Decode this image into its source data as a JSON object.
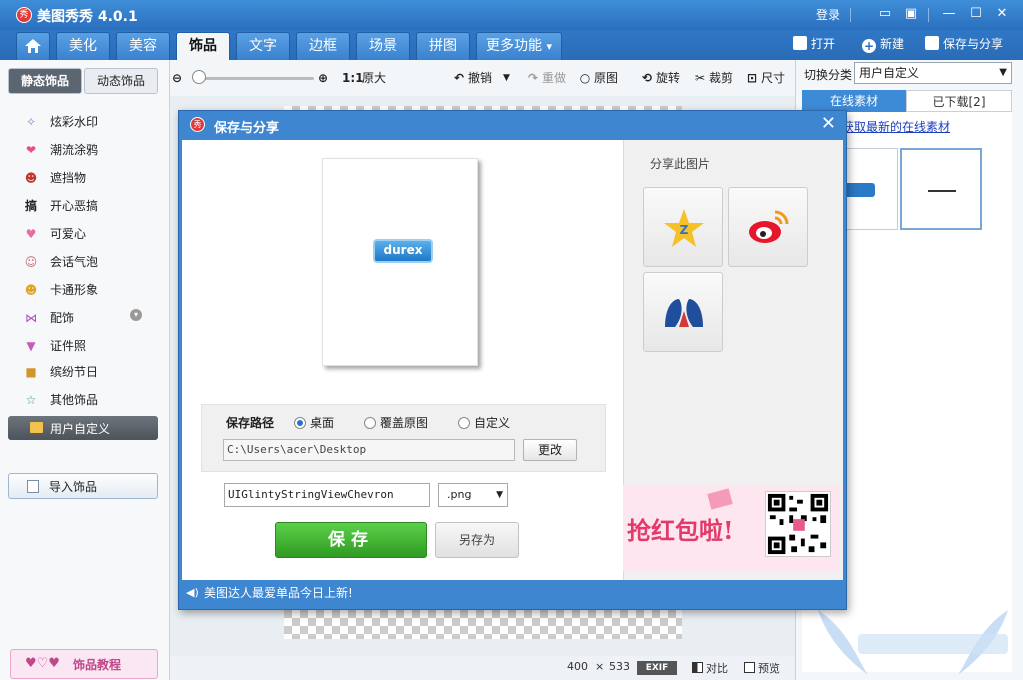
{
  "app": {
    "title": "美图秀秀 4.0.1",
    "login": "登录",
    "logo_text": "秀"
  },
  "menu": {
    "tabs": [
      {
        "label": "美化"
      },
      {
        "label": "美容"
      },
      {
        "label": "饰品"
      },
      {
        "label": "文字"
      },
      {
        "label": "边框"
      },
      {
        "label": "场景"
      },
      {
        "label": "拼图"
      },
      {
        "label": "更多功能"
      }
    ],
    "more_caret": "▾",
    "actions": {
      "open": "打开",
      "new": "新建",
      "save_share": "保存与分享"
    }
  },
  "left_panel": {
    "tab_static": "静态饰品",
    "tab_dynamic": "动态饰品",
    "items": [
      {
        "label": "炫彩水印",
        "icon": "sparkle-icon"
      },
      {
        "label": "潮流涂鸦",
        "icon": "lips-icon"
      },
      {
        "label": "遮挡物",
        "icon": "mask-icon"
      },
      {
        "label": "开心恶搞",
        "icon": "gao-icon"
      },
      {
        "label": "可爱心",
        "icon": "heart-icon"
      },
      {
        "label": "会话气泡",
        "icon": "bubble-icon"
      },
      {
        "label": "卡通形象",
        "icon": "cartoon-icon"
      },
      {
        "label": "配饰",
        "icon": "bow-icon"
      },
      {
        "label": "证件照",
        "icon": "shirt-icon"
      },
      {
        "label": "缤纷节日",
        "icon": "gift-icon"
      },
      {
        "label": "其他饰品",
        "icon": "star-icon"
      }
    ],
    "custom": "用户自定义",
    "import": "导入饰品",
    "tutorial": "饰品教程"
  },
  "toolbar": {
    "ratio": "1:1",
    "original_size": "原大",
    "undo": "撤销",
    "redo": "重做",
    "original": "原图",
    "rotate": "旋转",
    "crop": "裁剪",
    "size": "尺寸",
    "zoom_level": 0.0
  },
  "statusbar": {
    "width": "400",
    "times": "×",
    "height": "533",
    "exif": "EXIF",
    "compare": "对比",
    "preview": "预览"
  },
  "right_panel": {
    "category_label": "切换分类",
    "category_value": "用户自定义",
    "tab_online": "在线素材",
    "tab_downloaded": "已下载[2]",
    "link": "获取最新的在线素材"
  },
  "dialog": {
    "title": "保存与分享",
    "preview_logo_text": "durex",
    "save_path_label": "保存路径",
    "options": [
      {
        "label": "桌面",
        "checked": true
      },
      {
        "label": "覆盖原图",
        "checked": false
      },
      {
        "label": "自定义",
        "checked": false
      }
    ],
    "path_value": "C:\\Users\\acer\\Desktop",
    "change_button": "更改",
    "filename_value": "UIGlintyStringViewChevron",
    "format_value": ".png",
    "save_button": "保存",
    "saveas_button": "另存为",
    "share_title": "分享此图片",
    "footer_text": "美图达人最爱单品今日上新!",
    "ad_text": "抢红包啦!"
  },
  "colors": {
    "title_blue": "#2a6fbe",
    "save_green": "#2f9b22",
    "link_blue": "#1b3fbf"
  }
}
